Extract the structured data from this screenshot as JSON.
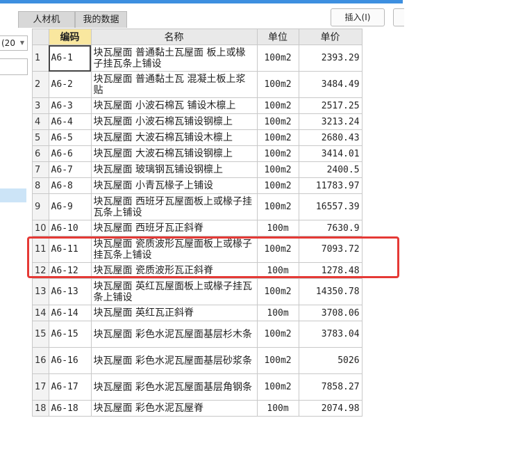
{
  "tabs": [
    {
      "label": "人材机"
    },
    {
      "label": "我的数据"
    }
  ],
  "toolbar": {
    "insert_label": "插入(I)"
  },
  "left_panel": {
    "select_value": "(20"
  },
  "table": {
    "columns": [
      "编码",
      "名称",
      "单位",
      "单价"
    ],
    "rows": [
      {
        "idx": "1",
        "code": "A6-1",
        "name": "块瓦屋面 普通黏土瓦屋面 板上或椽子挂瓦条上铺设",
        "unit": "100m2",
        "price": "2393.29"
      },
      {
        "idx": "2",
        "code": "A6-2",
        "name": "块瓦屋面 普通黏土瓦 混凝土板上浆贴",
        "unit": "100m2",
        "price": "3484.49"
      },
      {
        "idx": "3",
        "code": "A6-3",
        "name": "块瓦屋面 小波石棉瓦 铺设木檩上",
        "unit": "100m2",
        "price": "2517.25"
      },
      {
        "idx": "4",
        "code": "A6-4",
        "name": "块瓦屋面 小波石棉瓦铺设钢檩上",
        "unit": "100m2",
        "price": "3213.24"
      },
      {
        "idx": "5",
        "code": "A6-5",
        "name": "块瓦屋面 大波石棉瓦铺设木檩上",
        "unit": "100m2",
        "price": "2680.43"
      },
      {
        "idx": "6",
        "code": "A6-6",
        "name": "块瓦屋面 大波石棉瓦铺设钢檩上",
        "unit": "100m2",
        "price": "3414.01"
      },
      {
        "idx": "7",
        "code": "A6-7",
        "name": "块瓦屋面 玻璃钢瓦铺设钢檩上",
        "unit": "100m2",
        "price": "2400.5"
      },
      {
        "idx": "8",
        "code": "A6-8",
        "name": "块瓦屋面 小青瓦椽子上铺设",
        "unit": "100m2",
        "price": "11783.97"
      },
      {
        "idx": "9",
        "code": "A6-9",
        "name": "块瓦屋面 西班牙瓦屋面板上或椽子挂瓦条上铺设",
        "unit": "100m2",
        "price": "16557.39"
      },
      {
        "idx": "10",
        "code": "A6-10",
        "name": "块瓦屋面 西班牙瓦正斜脊",
        "unit": "100m",
        "price": "7630.9"
      },
      {
        "idx": "11",
        "code": "A6-11",
        "name": "块瓦屋面 瓷质波形瓦屋面板上或椽子挂瓦条上铺设",
        "unit": "100m2",
        "price": "7093.72"
      },
      {
        "idx": "12",
        "code": "A6-12",
        "name": "块瓦屋面 瓷质波形瓦正斜脊",
        "unit": "100m",
        "price": "1278.48"
      },
      {
        "idx": "13",
        "code": "A6-13",
        "name": "块瓦屋面 英红瓦屋面板上或椽子挂瓦条上铺设",
        "unit": "100m2",
        "price": "14350.78"
      },
      {
        "idx": "14",
        "code": "A6-14",
        "name": "块瓦屋面 英红瓦正斜脊",
        "unit": "100m",
        "price": "3708.06"
      },
      {
        "idx": "15",
        "code": "A6-15",
        "name": "块瓦屋面 彩色水泥瓦屋面基层杉木条",
        "unit": "100m2",
        "price": "3783.04"
      },
      {
        "idx": "16",
        "code": "A6-16",
        "name": "块瓦屋面 彩色水泥瓦屋面基层砂浆条",
        "unit": "100m2",
        "price": "5026"
      },
      {
        "idx": "17",
        "code": "A6-17",
        "name": "块瓦屋面 彩色水泥瓦屋面基层角钢条",
        "unit": "100m2",
        "price": "7858.27"
      },
      {
        "idx": "18",
        "code": "A6-18",
        "name": "块瓦屋面 彩色水泥瓦屋脊",
        "unit": "100m",
        "price": "2074.98"
      }
    ]
  },
  "colors": {
    "accent": "#3d8fe0",
    "header_highlight": "#f9e79f",
    "annotation": "#e53935"
  }
}
